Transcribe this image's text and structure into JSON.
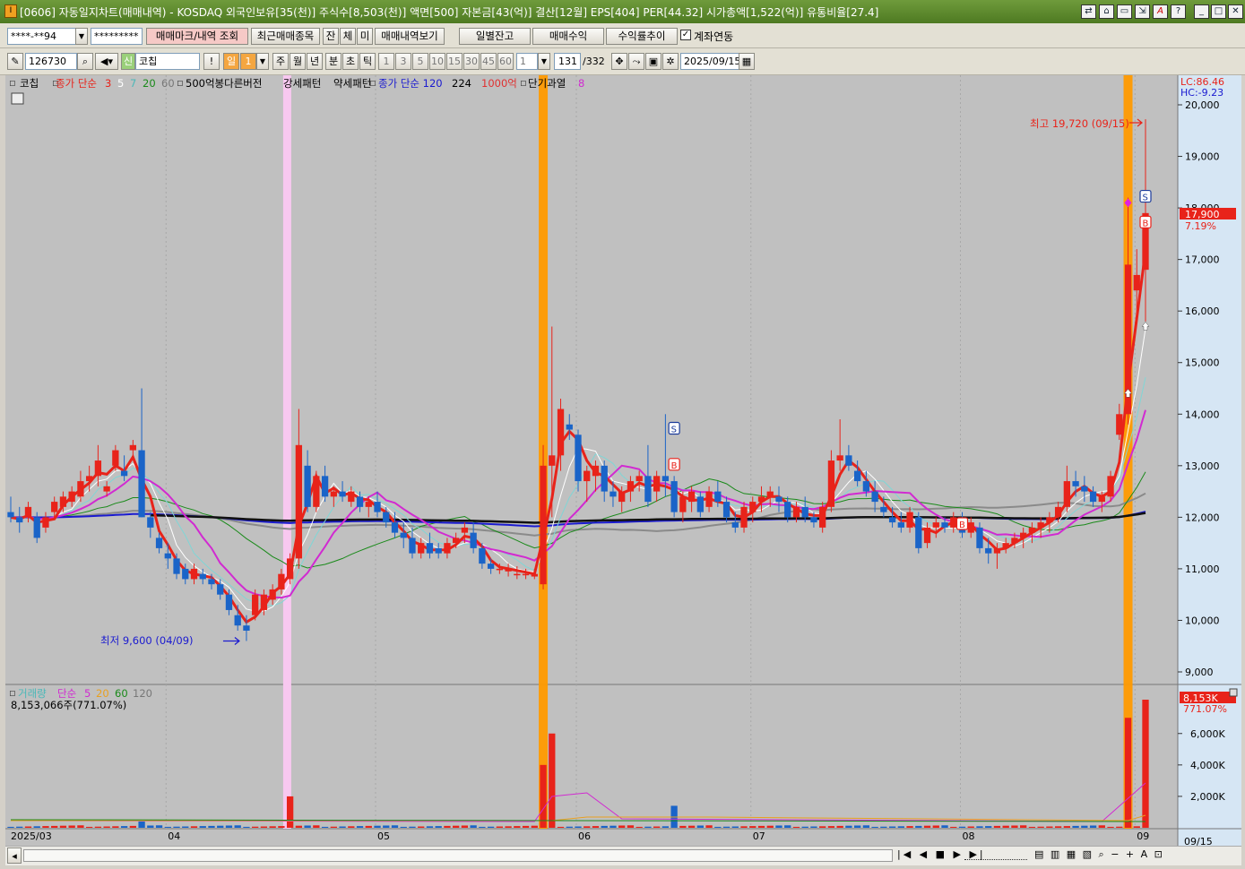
{
  "window": {
    "icon": "I",
    "title": "[0606] 자동일지차트(매매내역) - KOSDAQ 외국인보유[35(천)] 주식수[8,503(천)] 액면[500] 자본금[43(억)] 결산[12월] EPS[404] PER[44.32] 시가총액[1,522(억)] 유통비율[27.4]",
    "buttons": [
      "link-icon",
      "chart-icon",
      "window-icon",
      "export-icon",
      "font-icon",
      "help-icon",
      "minimize-icon",
      "maximize-icon",
      "close-icon"
    ]
  },
  "row1": {
    "account": "****-**94",
    "password": "*********",
    "btn_mark": "매매마크/내역 조회",
    "btn_recent": "최근매매종목",
    "btn_jan": "잔",
    "btn_che": "체",
    "btn_mi": "미",
    "btn_history": "매매내역보기",
    "btn_daily": "일별잔고",
    "btn_profit": "매매수익",
    "btn_return": "수익률추이",
    "link_label": "계좌연동",
    "link_checked": true
  },
  "row2": {
    "code": "126730",
    "shin": "신",
    "name": "코칩",
    "excl": "!",
    "period_sel": "일",
    "period_num": "1",
    "periods": [
      "주",
      "월",
      "년",
      "분",
      "초",
      "틱"
    ],
    "intervals": [
      "1",
      "3",
      "5",
      "10",
      "15",
      "30",
      "45",
      "60"
    ],
    "interval_input": "1",
    "count": "131",
    "total": "/332",
    "date": "2025/09/15"
  },
  "legend": {
    "stock": "코칩",
    "ma_label": "종가 단순",
    "ma3": "3",
    "ma5": "5",
    "ma7": "7",
    "ma20": "20",
    "ma60": "60",
    "pattern1": "500억봉다른버전",
    "pattern2": "강세패턴",
    "pattern3": "약세패턴",
    "ma120_label": "종가 단순 120",
    "v224": "224",
    "v1000": "1000억",
    "short": "단기과열",
    "short_n": "8"
  },
  "price_panel": {
    "lc": "LC:86.46",
    "hc": "HC:-9.23",
    "current_price": "17,900",
    "current_change": "7.19%",
    "high_label": "최고 19,720 (09/15)",
    "low_label": "최저 9,600 (04/09)",
    "y_ticks": [
      "20,000",
      "19,000",
      "18,000",
      "17,000",
      "16,000",
      "15,000",
      "14,000",
      "13,000",
      "12,000",
      "11,000",
      "10,000",
      "9,000"
    ]
  },
  "volume_panel": {
    "label": "거래량",
    "ma_label": "단순",
    "ma5": "5",
    "ma20": "20",
    "ma60": "60",
    "ma120": "120",
    "value_text": "8,153,066주(771.07%)",
    "current_volume": "8,153K",
    "current_pct": "771.07%",
    "y_ticks": [
      "6,000K",
      "4,000K",
      "2,000K"
    ]
  },
  "x_axis": {
    "labels": [
      "2025/03",
      "04",
      "05",
      "06",
      "07",
      "08",
      "09"
    ],
    "last": "09/15"
  },
  "markers": [
    "S",
    "B",
    "S",
    "B",
    "B"
  ],
  "colors": {
    "bg": "#c0c0c0",
    "up": "#e8231a",
    "down": "#1a64c8",
    "ma3": "#e8231a",
    "ma5": "#ffffff",
    "ma7": "#7fd6d6",
    "ma20": "#d12ad1",
    "ma60": "#1a8a1a",
    "ma120": "#1a1ad0",
    "ma224": "#111111",
    "ma_gray": "#8a8a8a",
    "highlight_orange": "#ff9a00",
    "highlight_pink": "#f8c8f0"
  },
  "chart_data": {
    "type": "candlestick",
    "x_axis_months": [
      "2025/03",
      "04",
      "05",
      "06",
      "07",
      "08",
      "09"
    ],
    "price_ylim": [
      9000,
      20000
    ],
    "high": {
      "value": 19720,
      "date": "09/15"
    },
    "low": {
      "value": 9600,
      "date": "04/09"
    },
    "last_close": 17900,
    "last_volume": 8153066,
    "candles": [
      [
        12100,
        12400,
        11900,
        12000
      ],
      [
        12000,
        12200,
        11700,
        11900
      ],
      [
        12000,
        12300,
        11900,
        12200
      ],
      [
        12000,
        12100,
        11500,
        11600
      ],
      [
        11800,
        12100,
        11700,
        12000
      ],
      [
        12100,
        12400,
        12000,
        12300
      ],
      [
        12200,
        12500,
        12100,
        12400
      ],
      [
        12300,
        12600,
        12200,
        12500
      ],
      [
        12400,
        12900,
        12300,
        12700
      ],
      [
        12700,
        13000,
        12500,
        12800
      ],
      [
        12800,
        13400,
        12600,
        13100
      ],
      [
        12500,
        12700,
        12400,
        12600
      ],
      [
        13000,
        13400,
        12900,
        13300
      ],
      [
        12900,
        13200,
        12700,
        12800
      ],
      [
        13300,
        13500,
        13100,
        13400
      ],
      [
        13300,
        14500,
        12000,
        12000
      ],
      [
        12000,
        12100,
        11600,
        11800
      ],
      [
        11600,
        11700,
        11300,
        11400
      ],
      [
        11300,
        11500,
        11000,
        11200
      ],
      [
        11200,
        11300,
        10800,
        10900
      ],
      [
        11000,
        11100,
        10700,
        10800
      ],
      [
        10800,
        11100,
        10700,
        11000
      ],
      [
        10900,
        11000,
        10700,
        10800
      ],
      [
        10800,
        10900,
        10600,
        10700
      ],
      [
        10700,
        10800,
        10400,
        10500
      ],
      [
        10500,
        10600,
        10100,
        10200
      ],
      [
        10100,
        10300,
        9800,
        9900
      ],
      [
        9900,
        10100,
        9600,
        9800
      ],
      [
        10100,
        10600,
        10000,
        10500
      ],
      [
        10200,
        10600,
        10100,
        10500
      ],
      [
        10400,
        10700,
        10300,
        10600
      ],
      [
        10600,
        11000,
        10500,
        10900
      ],
      [
        10800,
        11300,
        10700,
        11200
      ],
      [
        11200,
        14100,
        11000,
        13400
      ],
      [
        13000,
        13300,
        12100,
        12200
      ],
      [
        12200,
        12900,
        12100,
        12800
      ],
      [
        12800,
        13000,
        12300,
        12400
      ],
      [
        12400,
        12600,
        12200,
        12500
      ],
      [
        12500,
        12700,
        12300,
        12400
      ],
      [
        12300,
        12600,
        12200,
        12500
      ],
      [
        12400,
        12500,
        12100,
        12200
      ],
      [
        12200,
        12400,
        12000,
        12300
      ],
      [
        12300,
        12500,
        12000,
        12100
      ],
      [
        12100,
        12200,
        11800,
        11900
      ],
      [
        11900,
        12100,
        11600,
        11700
      ],
      [
        11700,
        11900,
        11400,
        11600
      ],
      [
        11600,
        11800,
        11200,
        11300
      ],
      [
        11300,
        11600,
        11200,
        11500
      ],
      [
        11500,
        11700,
        11200,
        11300
      ],
      [
        11400,
        11500,
        11200,
        11300
      ],
      [
        11300,
        11600,
        11200,
        11500
      ],
      [
        11500,
        11700,
        11400,
        11600
      ],
      [
        11700,
        11900,
        11500,
        11800
      ],
      [
        11700,
        11900,
        11300,
        11400
      ],
      [
        11400,
        11500,
        11000,
        11100
      ],
      [
        11100,
        11200,
        10900,
        11000
      ],
      [
        11000,
        11100,
        10900,
        11000
      ],
      [
        10950,
        11100,
        10850,
        11000
      ],
      [
        10900,
        11050,
        10800,
        10900
      ],
      [
        10900,
        11000,
        10800,
        10900
      ],
      [
        10850,
        11000,
        10800,
        10900
      ],
      [
        10700,
        13400,
        10600,
        13000
      ],
      [
        13000,
        15700,
        12000,
        13200
      ],
      [
        13200,
        14300,
        12900,
        14100
      ],
      [
        13800,
        14000,
        13500,
        13700
      ],
      [
        13600,
        13700,
        12500,
        12700
      ],
      [
        12700,
        13000,
        12300,
        12900
      ],
      [
        12800,
        13100,
        12500,
        13000
      ],
      [
        13000,
        13100,
        12300,
        12500
      ],
      [
        12500,
        12700,
        12200,
        12400
      ],
      [
        12300,
        12600,
        12100,
        12500
      ],
      [
        12500,
        12800,
        12300,
        12700
      ],
      [
        12700,
        12900,
        12500,
        12800
      ],
      [
        12800,
        13400,
        12200,
        12300
      ],
      [
        12500,
        12900,
        12300,
        12800
      ],
      [
        12800,
        14000,
        12400,
        12700
      ],
      [
        12700,
        12800,
        12000,
        12100
      ],
      [
        12100,
        12500,
        11900,
        12400
      ],
      [
        12300,
        12600,
        12100,
        12500
      ],
      [
        12400,
        12500,
        12000,
        12100
      ],
      [
        12200,
        12600,
        12100,
        12500
      ],
      [
        12500,
        12700,
        12200,
        12300
      ],
      [
        12300,
        12400,
        11900,
        12000
      ],
      [
        11900,
        12100,
        11700,
        11800
      ],
      [
        11800,
        12300,
        11700,
        12200
      ],
      [
        12100,
        12400,
        11900,
        12300
      ],
      [
        12300,
        12600,
        12100,
        12400
      ],
      [
        12400,
        12600,
        12200,
        12500
      ],
      [
        12400,
        12600,
        12100,
        12300
      ],
      [
        12300,
        12400,
        11900,
        12000
      ],
      [
        12000,
        12300,
        11900,
        12200
      ],
      [
        12200,
        12400,
        11900,
        12000
      ],
      [
        12000,
        12100,
        11800,
        11900
      ],
      [
        11800,
        12300,
        11700,
        12200
      ],
      [
        12200,
        13300,
        12100,
        13100
      ],
      [
        13100,
        13900,
        12900,
        13200
      ],
      [
        13200,
        13400,
        12900,
        13000
      ],
      [
        12900,
        13100,
        12600,
        12700
      ],
      [
        12700,
        12900,
        12400,
        12500
      ],
      [
        12500,
        12700,
        12100,
        12300
      ],
      [
        12200,
        12400,
        12000,
        12100
      ],
      [
        12000,
        12200,
        11800,
        11900
      ],
      [
        11900,
        12100,
        11700,
        11800
      ],
      [
        11800,
        12200,
        11700,
        12100
      ],
      [
        12000,
        12100,
        11300,
        11400
      ],
      [
        11500,
        11900,
        11400,
        11800
      ],
      [
        11800,
        12000,
        11600,
        11900
      ],
      [
        11900,
        12000,
        11700,
        11800
      ],
      [
        11800,
        12100,
        11700,
        12000
      ],
      [
        11900,
        12100,
        11600,
        11700
      ],
      [
        11700,
        12000,
        11600,
        11900
      ],
      [
        11800,
        11900,
        11300,
        11400
      ],
      [
        11400,
        11600,
        11100,
        11300
      ],
      [
        11300,
        11500,
        11000,
        11400
      ],
      [
        11400,
        11600,
        11300,
        11500
      ],
      [
        11500,
        11700,
        11400,
        11600
      ],
      [
        11600,
        11800,
        11400,
        11700
      ],
      [
        11700,
        11900,
        11500,
        11800
      ],
      [
        11800,
        12000,
        11600,
        11900
      ],
      [
        11900,
        12100,
        11700,
        12000
      ],
      [
        12000,
        12300,
        11900,
        12200
      ],
      [
        12200,
        13000,
        12100,
        12700
      ],
      [
        12700,
        12900,
        12400,
        12600
      ],
      [
        12600,
        12800,
        12300,
        12500
      ],
      [
        12500,
        12600,
        12200,
        12300
      ],
      [
        12300,
        12500,
        12100,
        12400
      ],
      [
        12400,
        12900,
        12300,
        12800
      ],
      [
        13600,
        14200,
        13500,
        14000
      ],
      [
        14000,
        18200,
        13800,
        16900
      ],
      [
        16400,
        17200,
        15900,
        16700
      ],
      [
        16800,
        19720,
        15800,
        17900
      ]
    ],
    "volume_spikes_k": {
      "15": 400,
      "32": 2000,
      "61": 4000,
      "62": 6000,
      "76": 1400,
      "128": 7000,
      "130": 8153
    }
  }
}
